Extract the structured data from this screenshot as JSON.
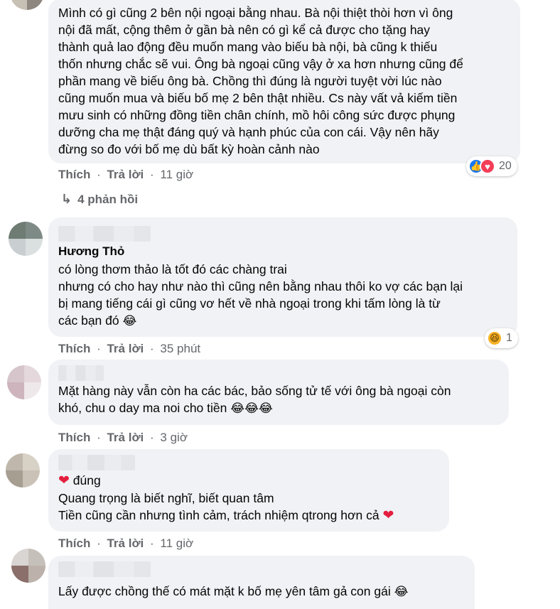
{
  "comments": [
    {
      "lines": [
        "Mình có gì cũng 2 bên nội ngoại bằng nhau. Bà nội thiệt thòi hơn vì ông",
        "nội đã mất, cộng thêm ở gần bà nên có gì kể cả được cho tặng hay",
        "thành quả lao động đều muốn mang vào biếu bà nội, bà cũng k thiếu",
        "thốn nhưng chắc sẽ vui. Ông bà ngoại cũng vậy ở xa hơn nhưng cũng để",
        "phần mang về biếu ông bà. Chồng thì đúng là người tuyệt vời lúc nào",
        "cũng muốn mua và biếu bố mẹ 2 bên thật nhiều. Cs này vất vả kiếm tiền",
        "mưu sinh có những đồng tiền chân chính, mồ hôi công sức được phụng",
        "dưỡng cha mẹ thật đáng quý và hạnh phúc của con cái. Vậy nên hãy",
        "đừng so đo với bố mẹ dù bất kỳ hoàn cảnh nào"
      ],
      "like": "Thích",
      "reply": "Trả lời",
      "time": "11 giờ",
      "reaction_count": "20",
      "replies_label": "4 phản hồi"
    },
    {
      "author": "Hương Thỏ",
      "lines": [
        "có lòng thơm thảo là tốt đó các chàng trai",
        "nhưng có cho hay như nào thì cũng nên bằng nhau thôi ko vợ các bạn lại",
        "bị mang tiếng cái gì cũng vơ hết về nhà ngoại trong khi tấm lòng là từ",
        "các bạn đó"
      ],
      "like": "Thích",
      "reply": "Trả lời",
      "time": "35 phút",
      "reaction_count": "1"
    },
    {
      "lines": [
        "Mặt hàng này vẫn còn ha các bác, bảo sống tử tế với ông bà ngoại còn",
        "khó, chu o day ma noi cho tiền"
      ],
      "like": "Thích",
      "reply": "Trả lời",
      "time": "3 giờ"
    },
    {
      "lines": [
        "đúng",
        "Quang trọng là biết nghĩ, biết quan tâm",
        "Tiền cũng cần nhưng tình cảm, trách nhiệm qtrong hơn cả"
      ],
      "like": "Thích",
      "reply": "Trả lời",
      "time": "11 giờ"
    },
    {
      "lines": [
        "Lấy được chồng thế có mát mặt k bố mẹ yên tâm gả con gái"
      ]
    }
  ],
  "separator": "·",
  "icons": {
    "like": "thumbs-up-icon",
    "love": "heart-icon",
    "haha": "laughing-face-icon",
    "reply_arrow": "reply-arrow-icon"
  },
  "colors": {
    "bubble": "#f0f2f5",
    "meta": "#65676b",
    "like_blue": "#1877f2",
    "love_red": "#f33e58"
  }
}
